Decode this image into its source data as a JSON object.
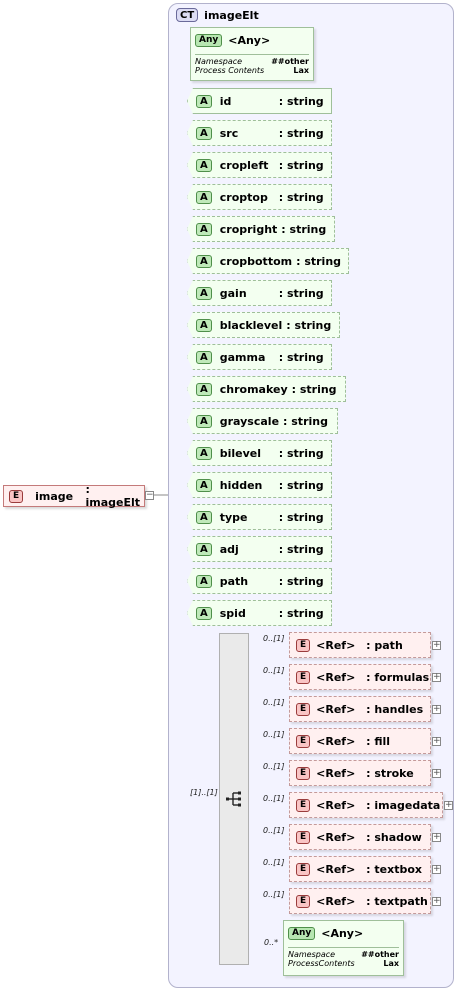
{
  "complex_type": {
    "badge": "CT",
    "name": "imageElt"
  },
  "root_element": {
    "badge": "E",
    "name": "image",
    "type": ": imageElt"
  },
  "any_top": {
    "badge": "Any",
    "label": "<Any>",
    "namespace_label": "Namespace",
    "namespace_value": "##other",
    "process_label": "Process Contents",
    "process_value": "Lax"
  },
  "attributes": [
    {
      "badge": "A",
      "name": "id",
      "type": ": string",
      "use": "required"
    },
    {
      "badge": "A",
      "name": "src",
      "type": ": string",
      "use": "optional"
    },
    {
      "badge": "A",
      "name": "cropleft",
      "type": ": string",
      "use": "optional"
    },
    {
      "badge": "A",
      "name": "croptop",
      "type": ": string",
      "use": "optional"
    },
    {
      "badge": "A",
      "name": "cropright",
      "type": ": string",
      "use": "optional"
    },
    {
      "badge": "A",
      "name": "cropbottom",
      "type": ": string",
      "use": "optional"
    },
    {
      "badge": "A",
      "name": "gain",
      "type": ": string",
      "use": "optional"
    },
    {
      "badge": "A",
      "name": "blacklevel",
      "type": ": string",
      "use": "optional"
    },
    {
      "badge": "A",
      "name": "gamma",
      "type": ": string",
      "use": "optional"
    },
    {
      "badge": "A",
      "name": "chromakey",
      "type": ": string",
      "use": "optional"
    },
    {
      "badge": "A",
      "name": "grayscale",
      "type": ": string",
      "use": "optional"
    },
    {
      "badge": "A",
      "name": "bilevel",
      "type": ": string",
      "use": "optional"
    },
    {
      "badge": "A",
      "name": "hidden",
      "type": ": string",
      "use": "optional"
    },
    {
      "badge": "A",
      "name": "type",
      "type": ": string",
      "use": "optional"
    },
    {
      "badge": "A",
      "name": "adj",
      "type": ": string",
      "use": "optional"
    },
    {
      "badge": "A",
      "name": "path",
      "type": ": string",
      "use": "optional"
    },
    {
      "badge": "A",
      "name": "spid",
      "type": ": string",
      "use": "optional"
    }
  ],
  "sequence": {
    "cardinality": "[1]..[1]"
  },
  "refs": [
    {
      "card": "0..[1]",
      "badge": "E",
      "ref": "<Ref>",
      "name": ": path"
    },
    {
      "card": "0..[1]",
      "badge": "E",
      "ref": "<Ref>",
      "name": ": formulas"
    },
    {
      "card": "0..[1]",
      "badge": "E",
      "ref": "<Ref>",
      "name": ": handles"
    },
    {
      "card": "0..[1]",
      "badge": "E",
      "ref": "<Ref>",
      "name": ": fill"
    },
    {
      "card": "0..[1]",
      "badge": "E",
      "ref": "<Ref>",
      "name": ": stroke"
    },
    {
      "card": "0..[1]",
      "badge": "E",
      "ref": "<Ref>",
      "name": ": imagedata"
    },
    {
      "card": "0..[1]",
      "badge": "E",
      "ref": "<Ref>",
      "name": ": shadow"
    },
    {
      "card": "0..[1]",
      "badge": "E",
      "ref": "<Ref>",
      "name": ": textbox"
    },
    {
      "card": "0..[1]",
      "badge": "E",
      "ref": "<Ref>",
      "name": ": textpath"
    }
  ],
  "any_bottom": {
    "card": "0..*",
    "badge": "Any",
    "label": "<Any>",
    "namespace_label": "Namespace",
    "namespace_value": "##other",
    "process_label": "ProcessContents",
    "process_value": "Lax"
  },
  "colors": {
    "element_fill": "#fff0f0",
    "attribute_fill": "#f3fff0",
    "complex_type_fill": "#f3f3ff"
  }
}
